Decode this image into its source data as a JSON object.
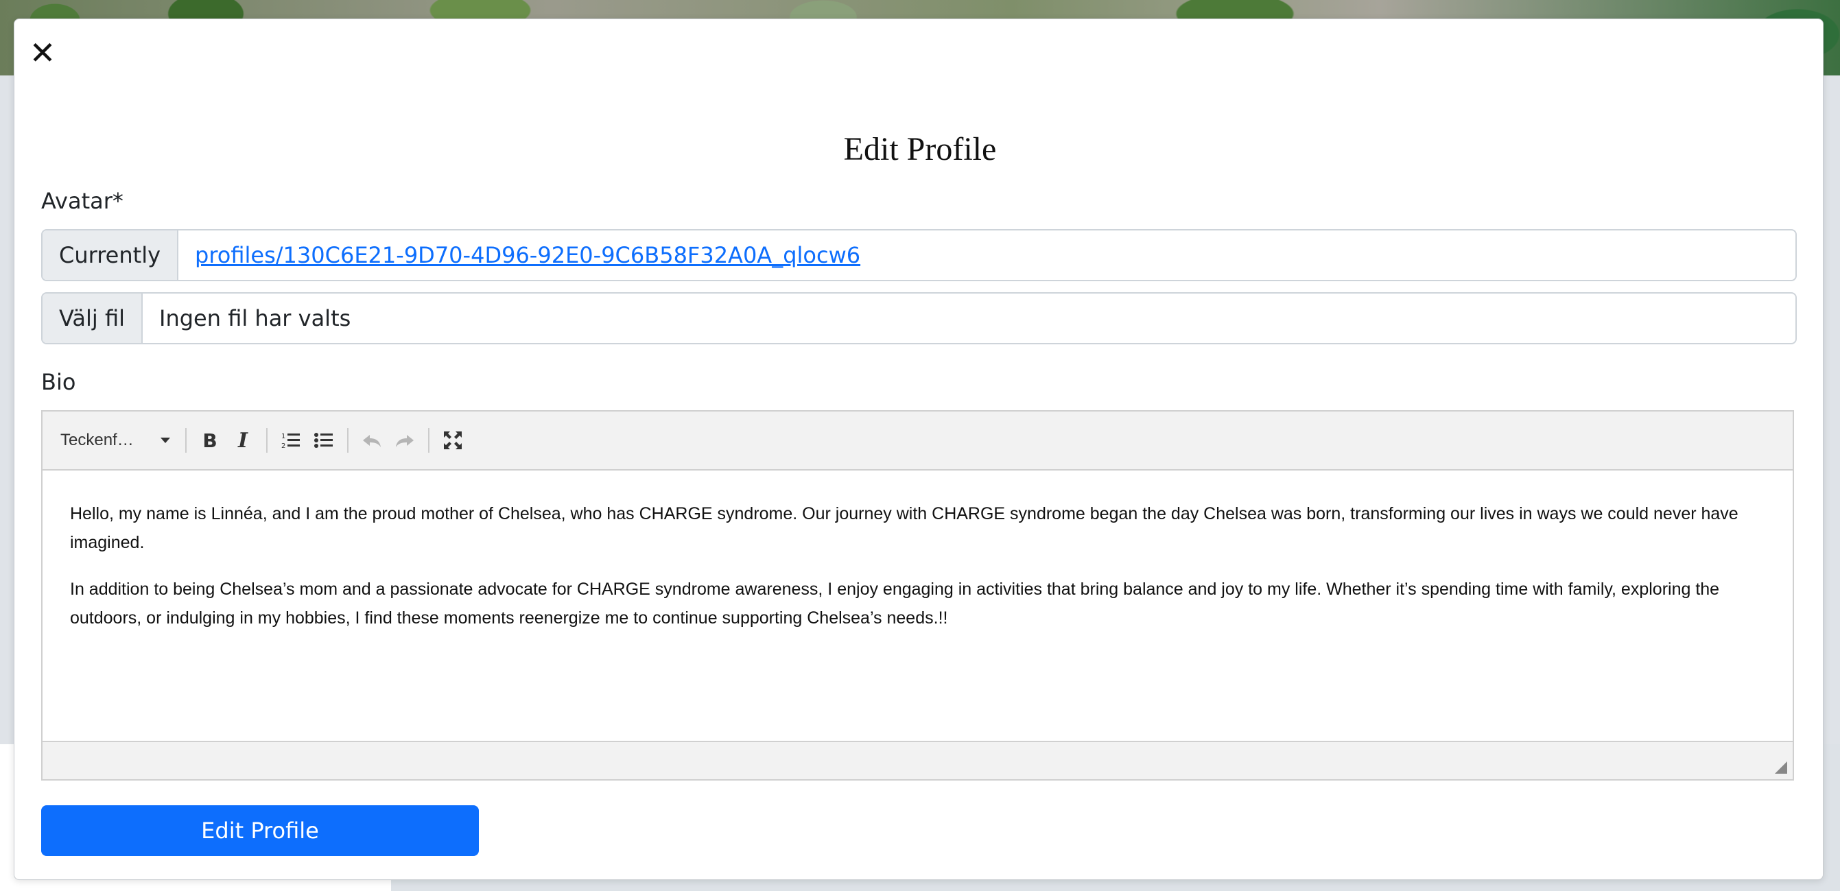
{
  "modal": {
    "close_icon": "close-icon",
    "title": "Edit Profile"
  },
  "avatar": {
    "label": "Avatar*",
    "current_addon": "Currently",
    "current_link": "profiles/130C6E21-9D70-4D96-92E0-9C6B58F32A0A_qlocw6",
    "file_button": "Välj fil",
    "file_status": "Ingen fil har valts"
  },
  "bio": {
    "label": "Bio",
    "toolbar": {
      "font_select": "Teckenf…",
      "icons": [
        "bold-icon",
        "italic-icon",
        "ordered-list-icon",
        "unordered-list-icon",
        "undo-icon",
        "redo-icon",
        "fullscreen-icon"
      ]
    },
    "paragraphs": [
      "Hello, my name is Linnéa, and I am the proud mother of Chelsea, who has CHARGE syndrome. Our journey with CHARGE syndrome began the day Chelsea was born, transforming our lives in ways we could never have imagined.",
      "In addition to being Chelsea’s mom and a passionate advocate for CHARGE syndrome awareness, I enjoy engaging in activities that bring balance and joy to my life. Whether it’s spending time with family, exploring the outdoors, or indulging in my hobbies, I find these moments reenergize me to continue supporting Chelsea’s needs.!!"
    ]
  },
  "submit": {
    "label": "Edit Profile"
  },
  "colors": {
    "primary": "#0d6efd",
    "addon_bg": "#e9ecef",
    "border": "#ced4da"
  }
}
